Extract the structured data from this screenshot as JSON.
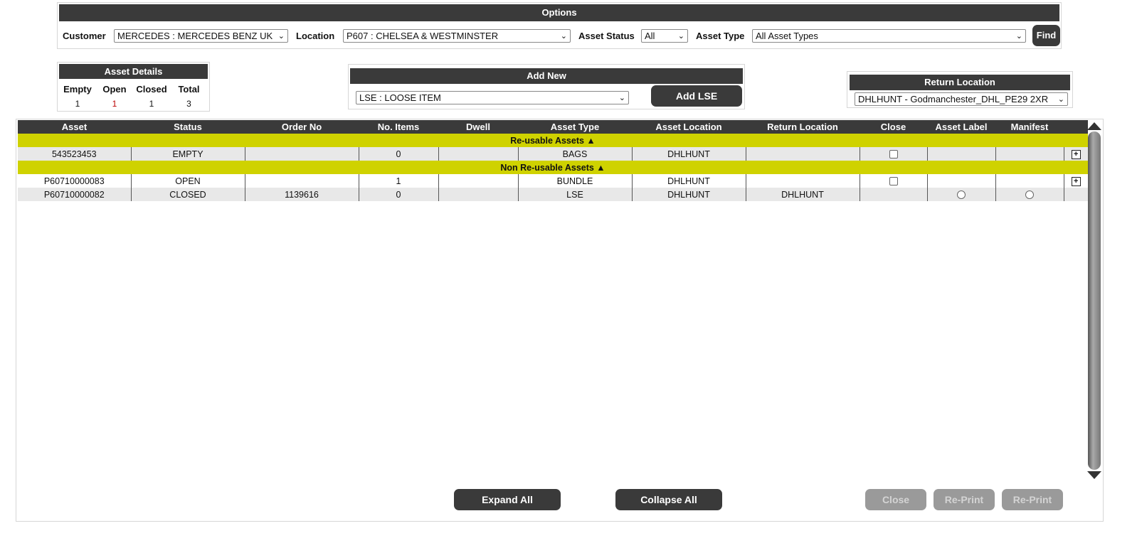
{
  "options": {
    "title": "Options",
    "customer_label": "Customer",
    "customer_value": "MERCEDES : MERCEDES BENZ UK",
    "location_label": "Location",
    "location_value": "P607 : CHELSEA & WESTMINSTER",
    "asset_status_label": "Asset Status",
    "asset_status_value": "All",
    "asset_type_label": "Asset Type",
    "asset_type_value": "All Asset Types",
    "find_label": "Find"
  },
  "asset_details": {
    "title": "Asset Details",
    "headers": [
      "Empty",
      "Open",
      "Closed",
      "Total"
    ],
    "values": [
      "1",
      "1",
      "1",
      "3"
    ]
  },
  "add_new": {
    "title": "Add New",
    "select_value": "LSE : LOOSE ITEM",
    "button_label": "Add LSE"
  },
  "return_location": {
    "title": "Return Location",
    "select_value": "DHLHUNT - Godmanchester_DHL_PE29 2XR"
  },
  "table": {
    "columns": [
      "Asset",
      "Status",
      "Order No",
      "No. Items",
      "Dwell",
      "Asset Type",
      "Asset Location",
      "Return Location",
      "Close",
      "Asset Label",
      "Manifest"
    ],
    "groups": [
      {
        "label": "Re-usable Assets ▲",
        "rows": [
          {
            "asset": "543523453",
            "status": "EMPTY",
            "order_no": "",
            "items": "0",
            "dwell": "",
            "asset_type": "BAGS",
            "asset_location": "DHLHUNT",
            "return_location": ""
          }
        ]
      },
      {
        "label": "Non Re-usable Assets ▲",
        "rows": [
          {
            "asset": "P60710000083",
            "status": "OPEN",
            "order_no": "",
            "items": "1",
            "dwell": "",
            "asset_type": "BUNDLE",
            "asset_location": "DHLHUNT",
            "return_location": ""
          },
          {
            "asset": "P60710000082",
            "status": "CLOSED",
            "order_no": "1139616",
            "items": "0",
            "dwell": "",
            "asset_type": "LSE",
            "asset_location": "DHLHUNT",
            "return_location": "DHLHUNT"
          }
        ]
      }
    ]
  },
  "footer": {
    "expand_all": "Expand All",
    "collapse_all": "Collapse All",
    "close": "Close",
    "reprint_label": "Re-Print",
    "reprint_manifest": "Re-Print"
  },
  "icons": {
    "dropdown": "chevron-down-icon",
    "expand": "plus-box-icon",
    "scroll_up": "triangle-up-icon",
    "scroll_down": "triangle-down-icon"
  },
  "colors": {
    "header_bg": "#3a3a3a",
    "group_bg": "#cfd200",
    "row_alt_bg": "#e8e8e8",
    "disabled_btn": "#9a9a9a"
  }
}
